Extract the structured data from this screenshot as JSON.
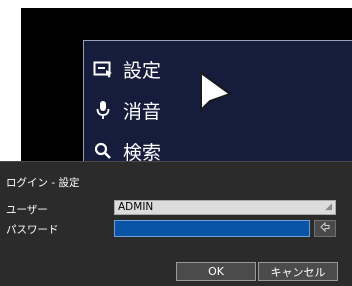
{
  "menu": {
    "items": [
      {
        "label": "設定",
        "icon": "settings-window-icon"
      },
      {
        "label": "消音",
        "icon": "microphone-icon"
      },
      {
        "label": "検索",
        "icon": "search-icon"
      }
    ]
  },
  "dialog": {
    "title": "ログイン - 設定",
    "user_label": "ユーザー",
    "user_value": "ADMIN",
    "password_label": "パスワード",
    "password_value": "",
    "ok_label": "OK",
    "cancel_label": "キャンセル"
  },
  "colors": {
    "menu_bg": "#161c3c",
    "dialog_bg": "#2b2b2b",
    "password_field": "#0a54a8"
  }
}
